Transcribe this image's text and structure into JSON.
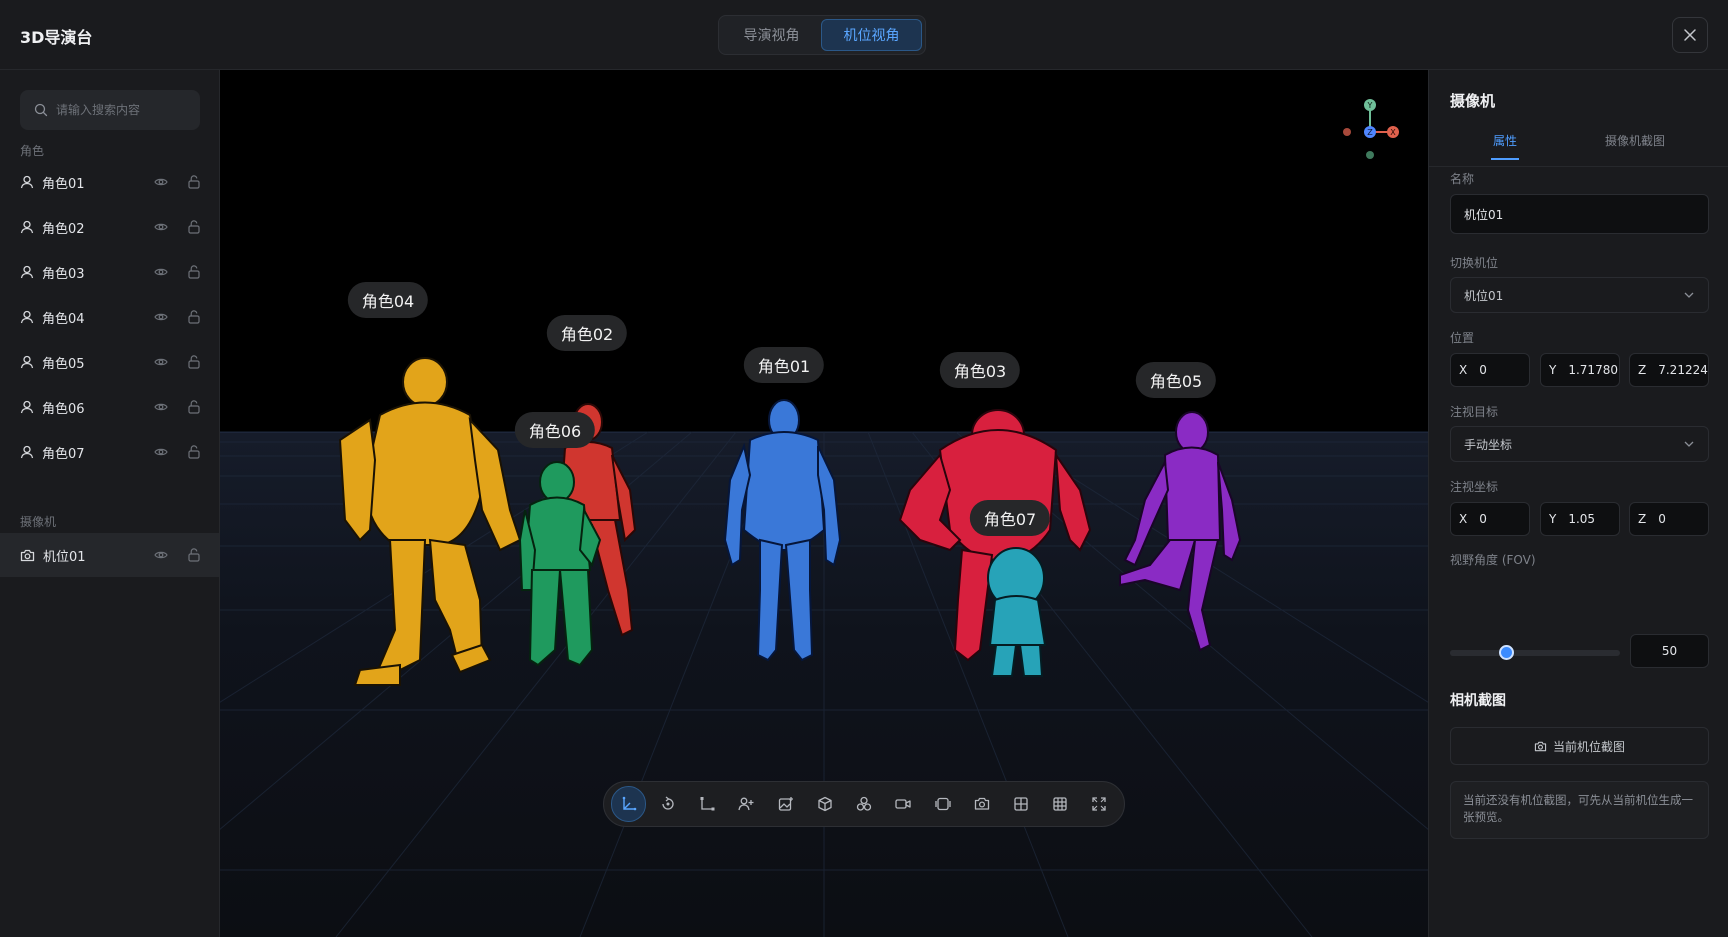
{
  "app": {
    "title": "3D导演台"
  },
  "view_tabs": [
    {
      "label": "导演视角",
      "active": false
    },
    {
      "label": "机位视角",
      "active": true
    }
  ],
  "left_panel": {
    "search_placeholder": "请输入搜索内容",
    "roles_section": "角色",
    "roles": [
      {
        "label": "角色01"
      },
      {
        "label": "角色02"
      },
      {
        "label": "角色03"
      },
      {
        "label": "角色04"
      },
      {
        "label": "角色05"
      },
      {
        "label": "角色06"
      },
      {
        "label": "角色07"
      }
    ],
    "cameras_section": "摄像机",
    "cameras": [
      {
        "label": "机位01",
        "selected": true
      }
    ]
  },
  "viewport": {
    "tags": [
      "角色04",
      "角色02",
      "角色06",
      "角色01",
      "角色03",
      "角色07",
      "角色05"
    ],
    "gizmo": {
      "y": "Y",
      "z": "Z",
      "x": "X"
    },
    "figure_colors": {
      "role04": "#e2a41a",
      "role02": "#d0362f",
      "role06": "#1f9a5e",
      "role01": "#3a78d8",
      "role03": "#d8203e",
      "role07": "#27a3b8",
      "role05": "#8a2bc4"
    }
  },
  "toolbar": {
    "tools": [
      {
        "icon": "axis-move-icon",
        "active": true
      },
      {
        "icon": "rotate-icon"
      },
      {
        "icon": "axis-scale-icon"
      },
      {
        "icon": "add-person-icon"
      },
      {
        "icon": "add-image-icon"
      },
      {
        "icon": "cube-icon"
      },
      {
        "icon": "spheres-icon"
      },
      {
        "icon": "video-camera-icon"
      },
      {
        "icon": "frame-icon"
      },
      {
        "icon": "camera-icon"
      },
      {
        "icon": "grid-2x2-icon"
      },
      {
        "icon": "grid-3x3-icon"
      },
      {
        "icon": "fullscreen-icon"
      }
    ]
  },
  "right_panel": {
    "title": "摄像机",
    "tabs": [
      "属性",
      "摄像机截图"
    ],
    "name_label": "名称",
    "name_value": "机位01",
    "switch_label": "切换机位",
    "switch_value": "机位01",
    "position_label": "位置",
    "position": {
      "x": "0",
      "y": "1.71780",
      "z": "7.21224"
    },
    "target_label": "注视目标",
    "target_value": "手动坐标",
    "target_coord_label": "注视坐标",
    "target_coord": {
      "x": "0",
      "y": "1.05",
      "z": "0"
    },
    "fov_label": "视野角度 (FOV)",
    "fov_value": "50",
    "fov_fraction": 0.33,
    "snapshot_title": "相机截图",
    "snapshot_button": "当前机位截图",
    "snapshot_note": "当前还没有机位截图，可先从当前机位生成一张预览。"
  }
}
